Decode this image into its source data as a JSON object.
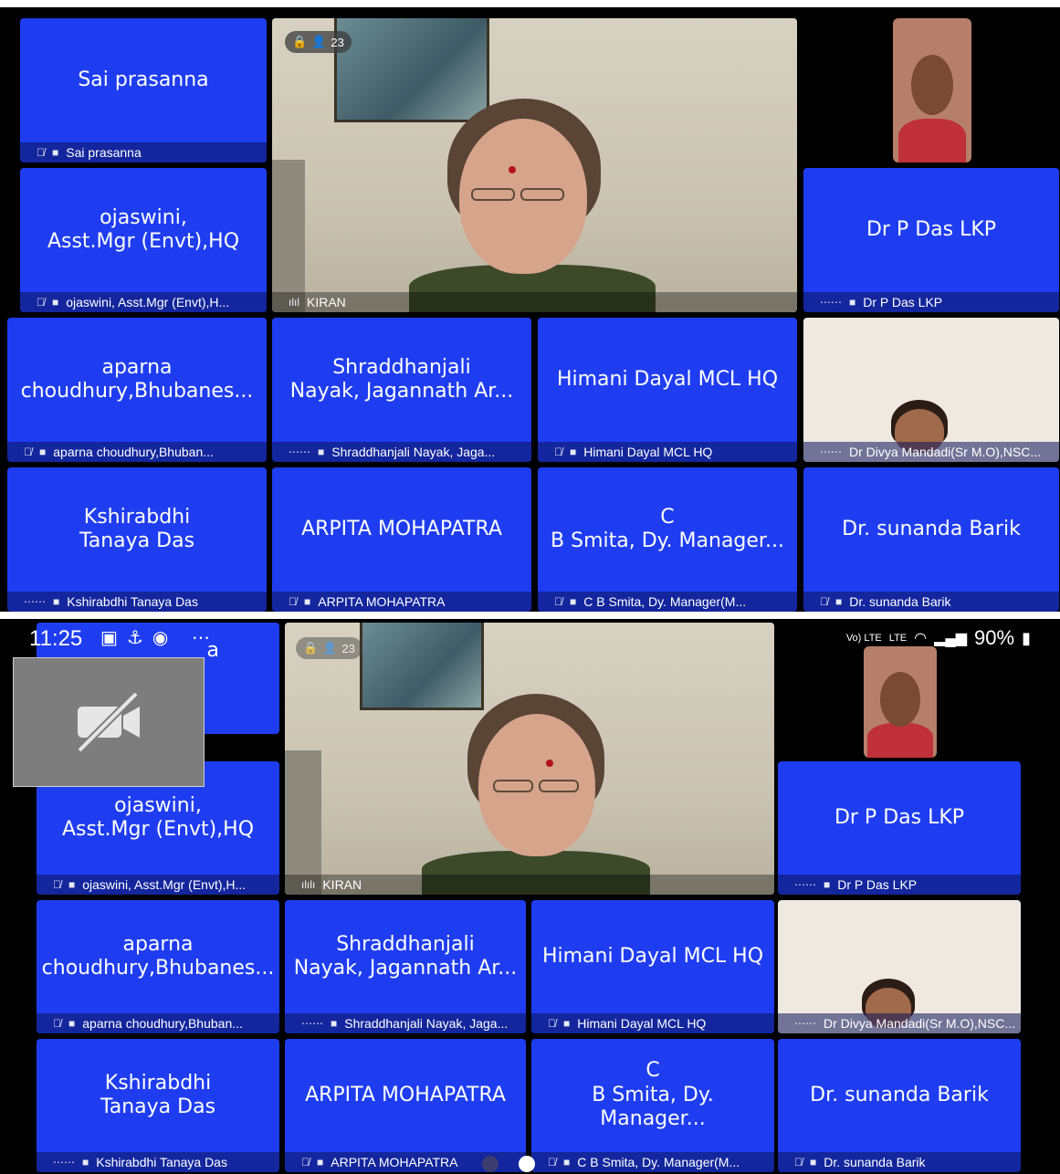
{
  "participant_count": "23",
  "speaker": "KIRAN",
  "status_bar": {
    "time": "11:25",
    "network": "Vo) LTE",
    "network2": "LTE",
    "battery": "90%"
  },
  "top": {
    "tiles": {
      "sai": {
        "name": "Sai prasanna",
        "label": "Sai prasanna"
      },
      "ojaswini": {
        "name": "ojaswini,\nAsst.Mgr (Envt),HQ",
        "label": "ojaswini, Asst.Mgr (Envt),H..."
      },
      "dpdas": {
        "name": "Dr P Das LKP",
        "label": "Dr P Das LKP"
      },
      "aparna": {
        "name": "aparna\nchoudhury,Bhubanes...",
        "label": "aparna choudhury,Bhuban..."
      },
      "shradd": {
        "name": "Shraddhanjali\nNayak, Jagannath Ar...",
        "label": "Shraddhanjali Nayak, Jaga..."
      },
      "himani": {
        "name": "Himani Dayal MCL HQ",
        "label": "Himani Dayal MCL HQ"
      },
      "divya": {
        "label": "Dr Divya Mandadi(Sr M.O),NSC..."
      },
      "kshira": {
        "name": "Kshirabdhi\nTanaya Das",
        "label": "Kshirabdhi Tanaya Das"
      },
      "arpita": {
        "name": "ARPITA MOHAPATRA",
        "label": "ARPITA MOHAPATRA"
      },
      "smita": {
        "name": "C\nB Smita, Dy. Manager...",
        "label": "C B Smita, Dy. Manager(M..."
      },
      "sunanda": {
        "name": "Dr. sunanda Barik",
        "label": "Dr. sunanda Barik"
      }
    }
  },
  "bottom": {
    "tiles": {
      "sai_partial": {
        "name": "a"
      },
      "ojaswini": {
        "name": "ojaswini,\nAsst.Mgr (Envt),HQ",
        "label": "ojaswini, Asst.Mgr (Envt),H..."
      },
      "dpdas": {
        "name": "Dr P Das LKP",
        "label": "Dr P Das LKP"
      },
      "aparna": {
        "name": "aparna\nchoudhury,Bhubanes...",
        "label": "aparna choudhury,Bhuban..."
      },
      "shradd": {
        "name": "Shraddhanjali\nNayak, Jagannath Ar...",
        "label": "Shraddhanjali Nayak, Jaga..."
      },
      "himani": {
        "name": "Himani Dayal MCL HQ",
        "label": "Himani Dayal MCL HQ"
      },
      "divya": {
        "label": "Dr Divya Mandadi(Sr M.O),NSC..."
      },
      "kshira": {
        "name": "Kshirabdhi\nTanaya Das",
        "label": "Kshirabdhi Tanaya Das"
      },
      "arpita": {
        "name": "ARPITA MOHAPATRA",
        "label": "ARPITA MOHAPATRA"
      },
      "smita": {
        "name": "C\nB Smita, Dy. Manager...",
        "label": "C B Smita, Dy. Manager(M..."
      },
      "sunanda": {
        "name": "Dr. sunanda Barik",
        "label": "Dr. sunanda Barik"
      }
    }
  },
  "icons": {
    "mic_muted": "mic-muted-icon",
    "cam_off": "camera-off-icon",
    "audio_wave": "audio-wave-icon",
    "lock": "lock-icon",
    "people": "people-icon"
  },
  "colors": {
    "tile_blue": "#1f3df0",
    "background": "#000000"
  }
}
